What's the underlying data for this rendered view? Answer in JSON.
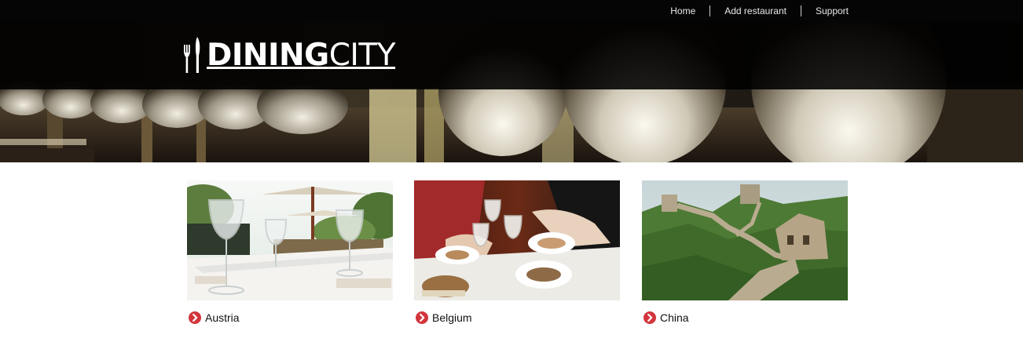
{
  "nav": {
    "items": [
      {
        "label": "Home"
      },
      {
        "label": "Add restaurant"
      },
      {
        "label": "Support"
      }
    ]
  },
  "logo": {
    "brand_bold": "DINING",
    "brand_light": "CITY",
    "icon": "fork-knife-icon"
  },
  "hero": {
    "image": "restaurant-lamps-banner"
  },
  "colors": {
    "topbar": "#050505",
    "accent": "#d3353c",
    "text": "#111111",
    "nav_text": "#e9e9e9"
  },
  "cards": [
    {
      "label": "Austria",
      "image": "outdoor-table-glasses",
      "icon": "chevron-right-circle-icon"
    },
    {
      "label": "Belgium",
      "image": "diners-at-table",
      "icon": "chevron-right-circle-icon"
    },
    {
      "label": "China",
      "image": "great-wall",
      "icon": "chevron-right-circle-icon"
    }
  ]
}
